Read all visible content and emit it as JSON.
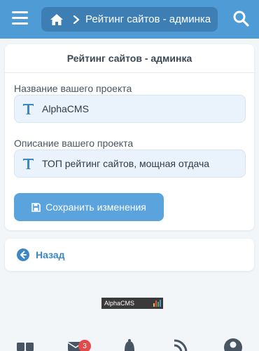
{
  "header": {
    "breadcrumb_title": "Рейтинг сайтов - админка",
    "icons": {
      "menu": "hamburger-menu-icon",
      "home": "home-icon",
      "separator": "chevron-right-icon",
      "search": "search-icon"
    }
  },
  "card": {
    "title": "Рейтинг сайтов - админка",
    "fields": [
      {
        "label": "Название вашего проекта",
        "value": "AlphaCMS",
        "icon": "text-icon"
      },
      {
        "label": "Описание вашего проекта",
        "value": "ТОП рейтинг сайтов, мощная отдача",
        "icon": "text-icon"
      }
    ],
    "save_label": "Сохранить изменения",
    "save_icon": "floppy-disk-icon"
  },
  "back": {
    "label": "Назад",
    "icon": "arrow-left-circle-icon"
  },
  "counter": {
    "label": "AlphaCMS"
  },
  "bottom_nav": {
    "items": [
      {
        "icon": "dashboard-icon"
      },
      {
        "icon": "mail-icon",
        "badge": "3"
      },
      {
        "icon": "bell-icon"
      },
      {
        "icon": "rss-icon"
      },
      {
        "icon": "user-icon"
      }
    ]
  },
  "colors": {
    "header_bg": "#4f9bd6",
    "breadcrumb_bg": "#3d7fb5",
    "accent": "#5aa3dd",
    "link": "#3d87c4",
    "field_bg": "#eaf3fc",
    "badge": "#e14b4b",
    "page_bg": "#f3f6f9"
  }
}
